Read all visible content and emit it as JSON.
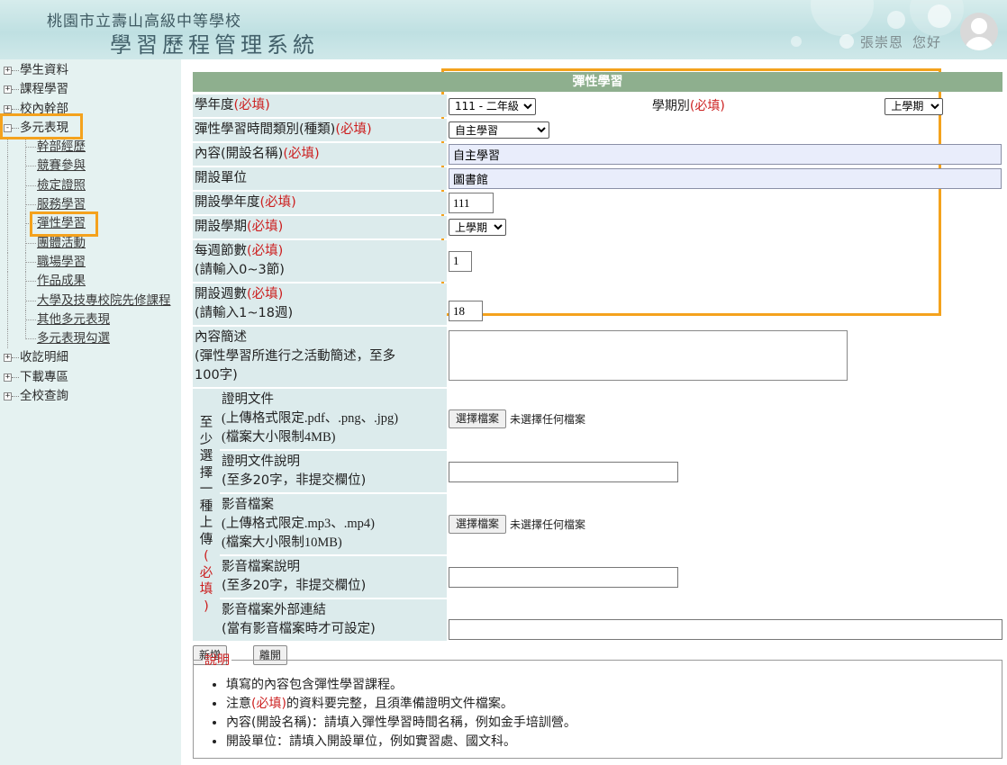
{
  "header": {
    "school": "桃園市立壽山高級中等學校",
    "system": "學習歷程管理系統",
    "user_name": "張崇恩",
    "greeting": "您好"
  },
  "sidebar": {
    "top_items": [
      {
        "label": "學生資料",
        "box": "+"
      },
      {
        "label": "課程學習",
        "box": "+"
      },
      {
        "label": "校內幹部",
        "box": "+"
      },
      {
        "label": "多元表現",
        "box": "-"
      }
    ],
    "sub_items": [
      "幹部經歷",
      "競賽參與",
      "檢定證照",
      "服務學習",
      "彈性學習",
      "團體活動",
      "職場學習",
      "作品成果",
      "大學及技專校院先修課程",
      "其他多元表現",
      "多元表現勾選"
    ],
    "bottom_items": [
      {
        "label": "收訖明細",
        "box": "+"
      },
      {
        "label": "下載專區",
        "box": "+"
      },
      {
        "label": "全校查詢",
        "box": "+"
      }
    ]
  },
  "form": {
    "title": "彈性學習",
    "required_mark": "(必填)",
    "school_year_label": "學年度",
    "school_year_value": "111 - 二年級",
    "semester_label": "學期別",
    "semester_value": "上學期",
    "type_label": "彈性學習時間類別(種類)",
    "type_value": "自主學習",
    "content_label": "內容(開設名稱)",
    "content_value": "自主學習",
    "unit_label": "開設單位",
    "unit_value": "圖書館",
    "open_year_label": "開設學年度",
    "open_year_value": "111",
    "open_semester_label": "開設學期",
    "open_semester_value": "上學期",
    "weekly_label": "每週節數",
    "weekly_hint": "(請輸入0~3節)",
    "weekly_value": "1",
    "weeks_label": "開設週數",
    "weeks_hint": "(請輸入1~18週)",
    "weeks_value": "18",
    "desc_label": "內容簡述",
    "desc_hint": "(彈性學習所進行之活動簡述，至多100字)",
    "upload_group_label": [
      "至",
      "少",
      "選",
      "擇",
      "一",
      "種",
      "上",
      "傳"
    ],
    "upload_group_required": [
      "(",
      "必",
      "填",
      ")"
    ],
    "proof_label": "證明文件",
    "proof_hint1": "(上傳格式限定.pdf、.png、.jpg)",
    "proof_hint2": "(檔案大小限制4MB)",
    "proof_desc_label": "證明文件說明",
    "proof_desc_hint": "(至多20字，非提交欄位)",
    "video_label": "影音檔案",
    "video_hint1": "(上傳格式限定.mp3、.mp4)",
    "video_hint2": "(檔案大小限制10MB)",
    "video_desc_label": "影音檔案說明",
    "video_desc_hint": "(至多20字，非提交欄位)",
    "video_link_label": "影音檔案外部連結",
    "video_link_hint": "(當有影音檔案時才可設定)",
    "choose_file": "選擇檔案",
    "no_file": "未選擇任何檔案",
    "add_button": "新增",
    "leave_button": "離開"
  },
  "notes": {
    "legend": "說明",
    "items": [
      "填寫的內容包含彈性學習課程。",
      "注意(必填)的資料要完整，且須準備證明文件檔案。",
      "內容(開設名稱)：請填入彈性學習時間名稱，例如金手培訓營。",
      "開設單位：請填入開設單位，例如實習處、國文科。"
    ]
  },
  "colors": {
    "highlight": "#f4a21d",
    "title_bar": "#8eaf8e",
    "required": "#cc1f1f",
    "label_bg": "#dcebec"
  }
}
